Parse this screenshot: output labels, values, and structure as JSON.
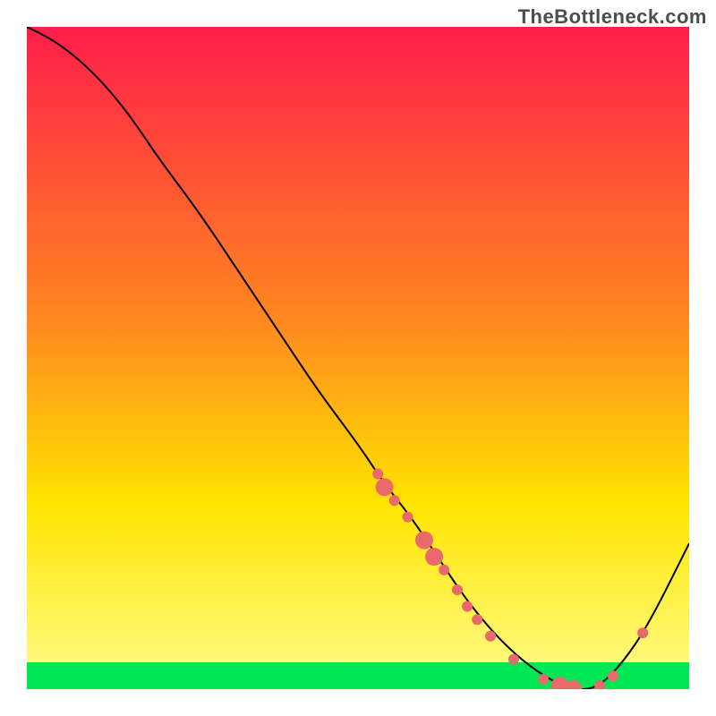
{
  "watermark": "TheBottleneck.com",
  "chart_data": {
    "type": "line",
    "title": "",
    "xlabel": "",
    "ylabel": "",
    "xlim": [
      0,
      100
    ],
    "ylim": [
      0,
      100
    ],
    "legend": false,
    "grid": false,
    "background_gradient": {
      "top_color": "#ff1d4a",
      "mid_color": "#ffe400",
      "bottom_band_color": "#00e756",
      "bottom_band_height_pct": 4
    },
    "series": [
      {
        "name": "bottleneck-curve",
        "stroke": "#000000",
        "stroke_width": 2,
        "x": [
          0,
          4,
          8,
          12,
          16,
          20,
          26,
          32,
          38,
          44,
          50,
          54,
          58,
          62,
          66,
          70,
          74,
          78,
          82,
          86,
          90,
          94,
          100
        ],
        "values": [
          100,
          98,
          95,
          91,
          86,
          80,
          72,
          63,
          54,
          45,
          37,
          31,
          26,
          20,
          14,
          9,
          5,
          2,
          0,
          0,
          4,
          10,
          22
        ]
      }
    ],
    "markers": {
      "name": "highlight-dots",
      "color": "#e86a6a",
      "radius_small": 6,
      "radius_large": 10,
      "points": [
        {
          "x": 53.0,
          "y": 32.5,
          "r": 6
        },
        {
          "x": 54.0,
          "y": 30.5,
          "r": 10
        },
        {
          "x": 55.5,
          "y": 28.5,
          "r": 6
        },
        {
          "x": 57.5,
          "y": 26.0,
          "r": 6
        },
        {
          "x": 60.0,
          "y": 22.5,
          "r": 10
        },
        {
          "x": 61.5,
          "y": 20.0,
          "r": 10
        },
        {
          "x": 63.0,
          "y": 18.0,
          "r": 6
        },
        {
          "x": 65.0,
          "y": 15.0,
          "r": 6
        },
        {
          "x": 66.5,
          "y": 12.5,
          "r": 6
        },
        {
          "x": 68.0,
          "y": 10.5,
          "r": 6
        },
        {
          "x": 70.0,
          "y": 8.0,
          "r": 6
        },
        {
          "x": 73.5,
          "y": 4.5,
          "r": 6
        },
        {
          "x": 78.0,
          "y": 1.5,
          "r": 6
        },
        {
          "x": 80.5,
          "y": 0.5,
          "r": 10
        },
        {
          "x": 82.5,
          "y": 0.0,
          "r": 10
        },
        {
          "x": 86.5,
          "y": 0.5,
          "r": 6
        },
        {
          "x": 88.5,
          "y": 2.0,
          "r": 6
        },
        {
          "x": 93.0,
          "y": 8.5,
          "r": 6
        }
      ]
    }
  }
}
